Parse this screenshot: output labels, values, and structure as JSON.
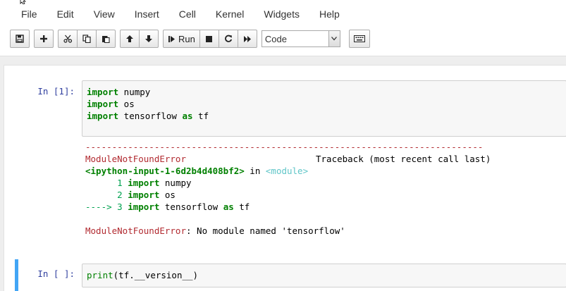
{
  "menubar": {
    "items": [
      "File",
      "Edit",
      "View",
      "Insert",
      "Cell",
      "Kernel",
      "Widgets",
      "Help"
    ]
  },
  "toolbar": {
    "run_label": "Run",
    "cell_type": "Code",
    "icons": [
      "save-icon",
      "plus-icon",
      "cut-icon",
      "copy-icon",
      "paste-icon",
      "arrow-up-icon",
      "arrow-down-icon",
      "run-icon",
      "stop-icon",
      "restart-icon",
      "fast-forward-icon",
      "keyboard-icon"
    ]
  },
  "cells": [
    {
      "prompt": "In [1]:",
      "code": [
        {
          "kw": "import",
          "rest": " numpy"
        },
        {
          "kw": "import",
          "rest": " os"
        },
        {
          "kw": "import",
          "rest": " tensorflow ",
          "kw2": "as",
          "rest2": " tf"
        }
      ],
      "output": {
        "dashes": "---------------------------------------------------------------------------",
        "error_name": "ModuleNotFoundError",
        "traceback_label": "Traceback (most recent call last)",
        "input_ref": "<ipython-input-1-6d2b4d408bf2>",
        "in_word": " in ",
        "module_ref": "<module>",
        "lines": [
          {
            "prefix": "      1 ",
            "kw": "import",
            "rest": " numpy"
          },
          {
            "prefix": "      2 ",
            "kw": "import",
            "rest": " os"
          },
          {
            "prefix": "----> 3 ",
            "kw": "import",
            "rest": " tensorflow ",
            "kw2": "as",
            "rest2": " tf"
          }
        ],
        "final_error": "ModuleNotFoundError",
        "final_message": ": No module named 'tensorflow'"
      }
    },
    {
      "prompt": "In [ ]:",
      "code_fn": "print",
      "code_open": "(",
      "code_body": "tf.__version__",
      "code_close": ")"
    }
  ],
  "colors": {
    "prompt": "#303f9f",
    "keyword": "#008000",
    "error": "#b22b31",
    "selected_cell_bar": "#42a5f5"
  }
}
